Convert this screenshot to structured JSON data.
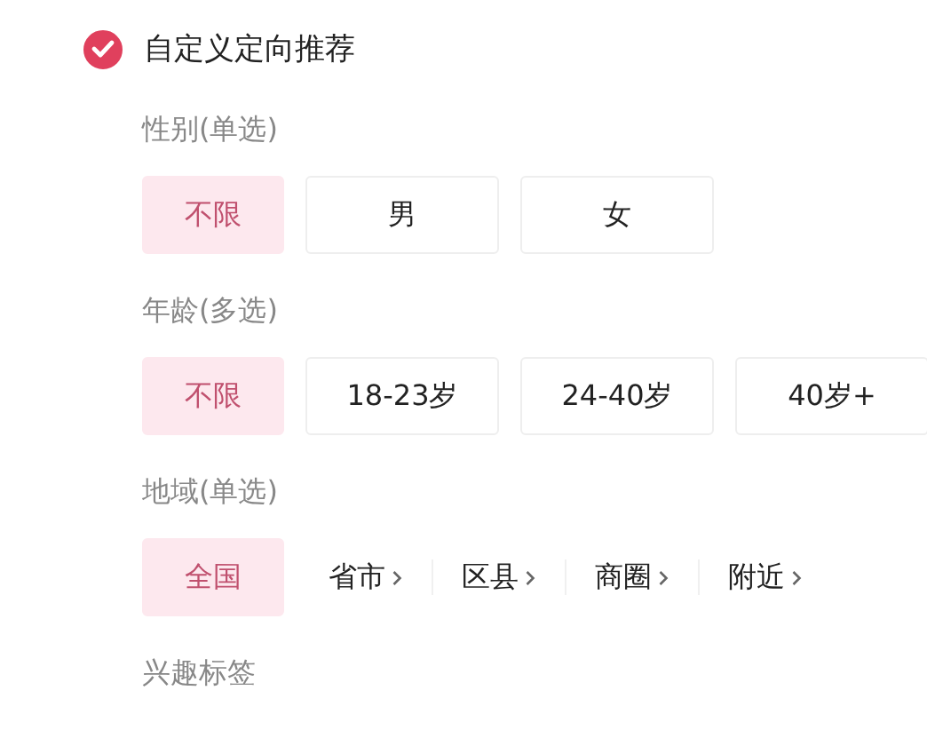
{
  "header": {
    "label": "自定义定向推荐",
    "checked": true
  },
  "sections": [
    {
      "label": "性别(单选)",
      "kind": "buttons",
      "options": [
        {
          "label": "不限",
          "selected": true
        },
        {
          "label": "男",
          "selected": false
        },
        {
          "label": "女",
          "selected": false
        }
      ]
    },
    {
      "label": "年龄(多选)",
      "kind": "buttons",
      "options": [
        {
          "label": "不限",
          "selected": true
        },
        {
          "label": "18-23岁",
          "selected": false
        },
        {
          "label": "24-40岁",
          "selected": false
        },
        {
          "label": "40岁+",
          "selected": false
        }
      ]
    },
    {
      "label": "地域(单选)",
      "kind": "links",
      "options": [
        {
          "label": "全国",
          "selected": true
        },
        {
          "label": "省市",
          "selected": false
        },
        {
          "label": "区县",
          "selected": false
        },
        {
          "label": "商圈",
          "selected": false
        },
        {
          "label": "附近",
          "selected": false
        }
      ]
    },
    {
      "label": "兴趣标签",
      "kind": "none"
    }
  ]
}
